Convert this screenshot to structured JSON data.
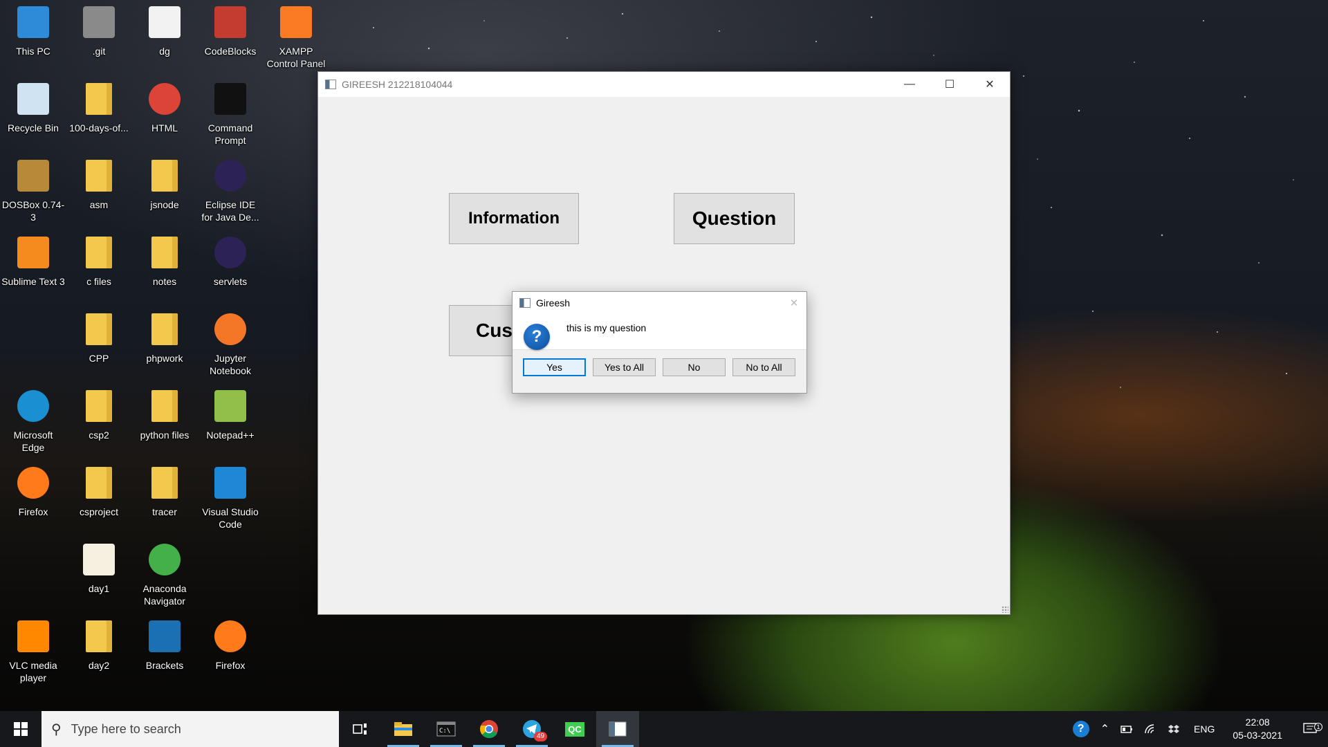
{
  "desktop": {
    "icons": [
      {
        "label": "This PC",
        "icon": "computer-icon"
      },
      {
        "label": ".git",
        "icon": "git-folder-icon"
      },
      {
        "label": "dg",
        "icon": "c-file-icon"
      },
      {
        "label": "CodeBlocks",
        "icon": "codeblocks-icon"
      },
      {
        "label": "XAMPP Control Panel",
        "icon": "xampp-icon"
      },
      {
        "label": "Recycle Bin",
        "icon": "recycle-bin-icon"
      },
      {
        "label": "100-days-of...",
        "icon": "folder-icon"
      },
      {
        "label": "HTML",
        "icon": "chrome-html-icon"
      },
      {
        "label": "Command Prompt",
        "icon": "terminal-icon"
      },
      {
        "label": "DOSBox 0.74-3",
        "icon": "dosbox-icon"
      },
      {
        "label": "asm",
        "icon": "folder-icon"
      },
      {
        "label": "jsnode",
        "icon": "folder-icon"
      },
      {
        "label": "Eclipse IDE for Java De...",
        "icon": "eclipse-icon"
      },
      {
        "label": "Sublime Text 3",
        "icon": "sublime-icon"
      },
      {
        "label": "c files",
        "icon": "folder-icon"
      },
      {
        "label": "notes",
        "icon": "folder-icon"
      },
      {
        "label": "servlets",
        "icon": "eclipse-icon"
      },
      {
        "label": "CPP",
        "icon": "folder-icon"
      },
      {
        "label": "phpwork",
        "icon": "folder-icon"
      },
      {
        "label": "Jupyter Notebook",
        "icon": "jupyter-icon"
      },
      {
        "label": "Microsoft Edge",
        "icon": "edge-icon"
      },
      {
        "label": "csp2",
        "icon": "folder-icon"
      },
      {
        "label": "python files",
        "icon": "folder-icon"
      },
      {
        "label": "Notepad++",
        "icon": "notepadpp-icon"
      },
      {
        "label": "Firefox",
        "icon": "firefox-icon"
      },
      {
        "label": "csproject",
        "icon": "folder-icon"
      },
      {
        "label": "tracer",
        "icon": "folder-icon"
      },
      {
        "label": "Visual Studio Code",
        "icon": "vscode-icon"
      },
      {
        "label": "day1",
        "icon": "chrome-file-icon"
      },
      {
        "label": "Anaconda Navigator",
        "icon": "anaconda-icon"
      },
      {
        "label": "VLC media player",
        "icon": "vlc-icon"
      },
      {
        "label": "day2",
        "icon": "folder-icon"
      },
      {
        "label": "Brackets",
        "icon": "brackets-icon"
      },
      {
        "label": "Firefox",
        "icon": "firefox-icon"
      }
    ]
  },
  "main_window": {
    "title": "GIREESH 212218104044",
    "buttons": {
      "information": "Information",
      "question": "Question",
      "custom_partial": "Cus"
    }
  },
  "dialog": {
    "title": "Gireesh",
    "message": "this is my question",
    "icon": "question-icon",
    "buttons": {
      "yes": "Yes",
      "yes_to_all": "Yes to All",
      "no": "No",
      "no_to_all": "No to All"
    }
  },
  "taskbar": {
    "search_placeholder": "Type here to search",
    "pinned": [
      "task-view-icon",
      "file-explorer-icon",
      "terminal-icon",
      "chrome-icon",
      "telegram-icon",
      "qc-icon",
      "qt-app-icon"
    ],
    "telegram_badge": "49",
    "qc_label": "QC",
    "tray": {
      "language": "ENG",
      "time": "22:08",
      "date": "05-03-2021",
      "notification_count": "1"
    }
  },
  "colors": {
    "accent": "#0078d7",
    "question_icon": "#0a4fa0",
    "taskbar": "#16181c",
    "window_bg": "#f0f0f0"
  }
}
